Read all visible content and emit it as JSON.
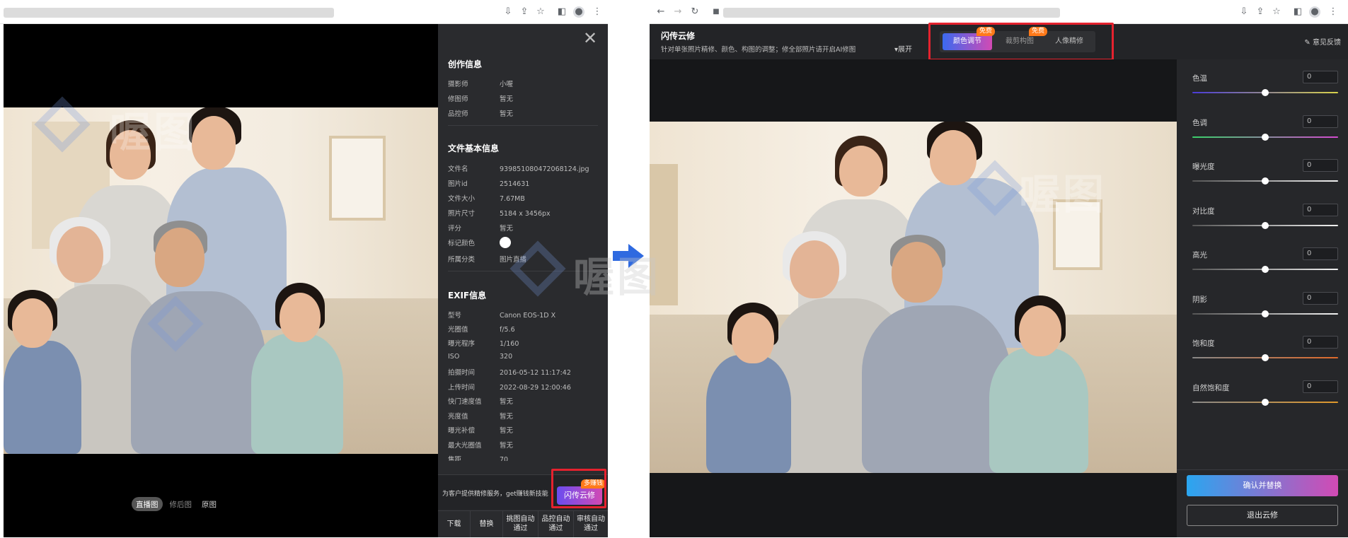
{
  "left": {
    "info": {
      "creation_title": "创作信息",
      "creation_rows": [
        {
          "k": "摄影师",
          "v": "小喔"
        },
        {
          "k": "修图师",
          "v": "暂无"
        },
        {
          "k": "品控师",
          "v": "暂无"
        }
      ],
      "file_title": "文件基本信息",
      "file_rows": [
        {
          "k": "文件名",
          "v": "939851080472068124.jpg"
        },
        {
          "k": "图片id",
          "v": "2514631"
        },
        {
          "k": "文件大小",
          "v": "7.67MB"
        },
        {
          "k": "照片尺寸",
          "v": "5184 x 3456px"
        },
        {
          "k": "评分",
          "v": "暂无"
        },
        {
          "k": "标记颜色",
          "v": ""
        },
        {
          "k": "所属分类",
          "v": "图片直播"
        }
      ],
      "exif_title": "EXIF信息",
      "exif_rows": [
        {
          "k": "型号",
          "v": "Canon EOS-1D X"
        },
        {
          "k": "光圈值",
          "v": "f/5.6"
        },
        {
          "k": "曝光程序",
          "v": "1/160"
        },
        {
          "k": "ISO",
          "v": "320"
        },
        {
          "k": "拍摄时间",
          "v": "2016-05-12 11:17:42"
        },
        {
          "k": "上传时间",
          "v": "2022-08-29 12:00:46"
        },
        {
          "k": "快门速度值",
          "v": "暂无"
        },
        {
          "k": "亮度值",
          "v": "暂无"
        },
        {
          "k": "曝光补偿",
          "v": "暂无"
        },
        {
          "k": "最大光圈值",
          "v": "暂无"
        },
        {
          "k": "焦距",
          "v": "70"
        }
      ],
      "promo_text": "为客户提供精修服务，get赚钱新技能",
      "promo_button": "闪传云修",
      "promo_badge": "多赚钱",
      "actions": [
        "下载",
        "替换",
        "挑图自动通过",
        "品控自动通过",
        "审核自动通过"
      ]
    },
    "photo_tabs": [
      "直播图",
      "修后图",
      "原图"
    ],
    "photo_tab_active": 0
  },
  "right": {
    "title": "闪传云修",
    "subtitle": "针对单张照片精修、颜色、构图的调整；修全部照片请开启AI修图",
    "expand": "展开",
    "tabs": [
      {
        "label": "颜色调节",
        "badge": "免费",
        "active": true
      },
      {
        "label": "裁剪构图",
        "badge": "免费",
        "active": false
      },
      {
        "label": "人像精修",
        "badge": "",
        "active": false
      }
    ],
    "feedback": "意见反馈",
    "sliders": [
      {
        "label": "色温",
        "value": "0",
        "colors": [
          "#4a3bd8",
          "#d8d24a"
        ]
      },
      {
        "label": "色调",
        "value": "0",
        "colors": [
          "#3ad06a",
          "#d44ad0"
        ]
      },
      {
        "label": "曝光度",
        "value": "0",
        "colors": [
          "#555555",
          "#f2f2f2"
        ]
      },
      {
        "label": "对比度",
        "value": "0",
        "colors": [
          "#555555",
          "#f2f2f2"
        ]
      },
      {
        "label": "高光",
        "value": "0",
        "colors": [
          "#555555",
          "#f2f2f2"
        ]
      },
      {
        "label": "阴影",
        "value": "0",
        "colors": [
          "#555555",
          "#f2f2f2"
        ]
      },
      {
        "label": "饱和度",
        "value": "0",
        "colors": [
          "#888888",
          "#e06a2a"
        ]
      },
      {
        "label": "自然饱和度",
        "value": "0",
        "colors": [
          "#888888",
          "#e0982a"
        ]
      }
    ],
    "confirm_button": "确认并替换",
    "exit_button": "退出云修"
  },
  "watermark_text": "喔图"
}
